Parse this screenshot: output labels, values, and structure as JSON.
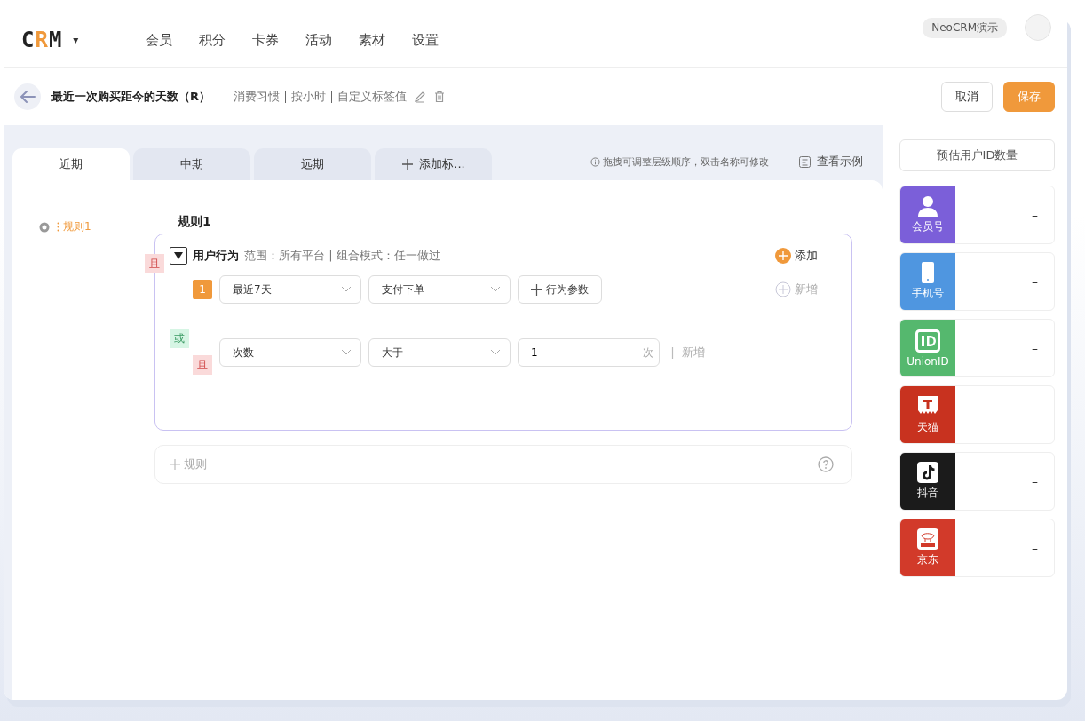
{
  "nav": {
    "logo": [
      {
        "text": "C",
        "accent": false
      },
      {
        "text": "R",
        "accent": true
      },
      {
        "text": "M",
        "accent": false
      }
    ],
    "caret": "▾",
    "items": [
      "会员",
      "积分",
      "卡券",
      "活动",
      "素材",
      "设置"
    ],
    "account": "NeoCRM演示"
  },
  "header": {
    "title": "最近一次购买距今的天数（R）",
    "meta": [
      "消费习惯",
      "按小时",
      "自定义标签值"
    ],
    "buttons": [
      {
        "label": "取消",
        "kind": "default"
      },
      {
        "label": "保存",
        "kind": "primary"
      }
    ]
  },
  "tabs": [
    {
      "label": "近期",
      "selected": true,
      "kind": "tab"
    },
    {
      "label": "中期",
      "selected": false,
      "kind": "tab"
    },
    {
      "label": "远期",
      "selected": false,
      "kind": "tab"
    },
    {
      "label": "添加标...",
      "selected": false,
      "kind": "add"
    }
  ],
  "hint": "拖拽可调整层级顺序，双击名称可修改",
  "example_link": "查看示例",
  "tree": [
    {
      "label": "规则1",
      "selected": true
    }
  ],
  "rule": {
    "title": "规则1",
    "logic": {
      "label": "且",
      "kind": "and"
    },
    "behavior": {
      "title": "用户行为",
      "scope": "范围：所有平台 | 组合模式：任一做过",
      "add": "添加",
      "new": "新增"
    },
    "event": {
      "index": "1",
      "selects": [
        "最近7天",
        "支付下单"
      ],
      "param_button": "行为参数"
    },
    "or_tag": {
      "label": "或",
      "kind": "or"
    },
    "condition": {
      "logic": {
        "label": "且",
        "kind": "and"
      },
      "selects": [
        "次数",
        "大于"
      ],
      "value": "1",
      "unit": "次",
      "new": "新增"
    }
  },
  "add_rule": "规则",
  "estimate": {
    "title": "预估用户ID数量",
    "channels": [
      {
        "label": "会员号",
        "kind": "member",
        "color": "#7b5fd9",
        "value": "–"
      },
      {
        "label": "手机号",
        "kind": "phone",
        "color": "#4f96e0",
        "value": "–"
      },
      {
        "label": "UnionID",
        "kind": "unionid",
        "color": "#55b86e",
        "value": "–"
      },
      {
        "label": "天猫",
        "kind": "tmall",
        "color": "#c8321f",
        "value": "–"
      },
      {
        "label": "抖音",
        "kind": "douyin",
        "color": "#1b1b1b",
        "value": "–"
      },
      {
        "label": "京东",
        "kind": "jd",
        "color": "#d23a2a",
        "value": "–"
      }
    ]
  }
}
